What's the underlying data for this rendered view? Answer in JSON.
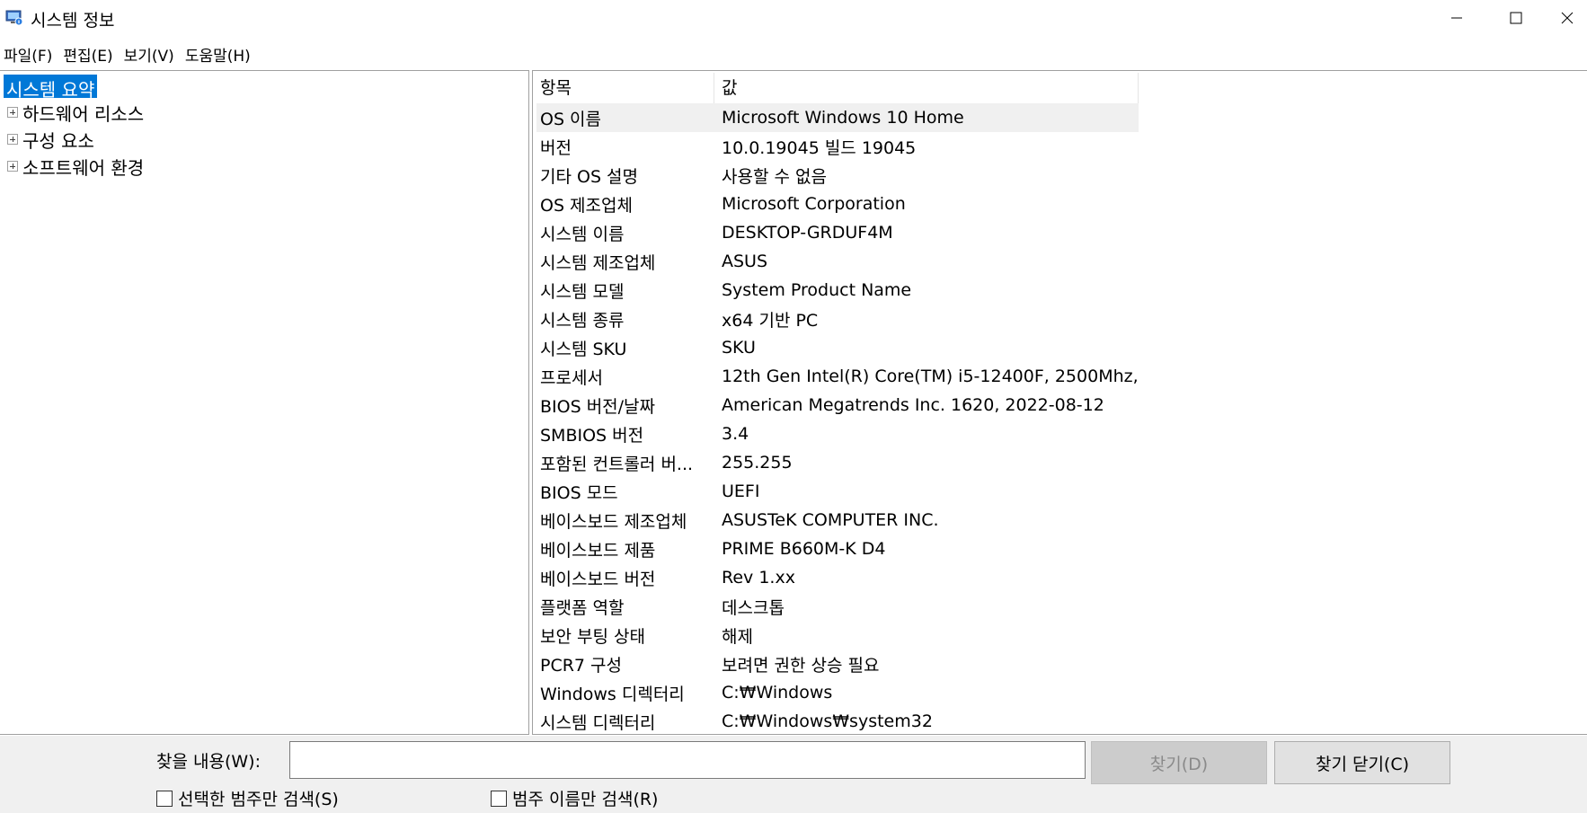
{
  "window": {
    "title": "시스템 정보",
    "icon": "system-info-icon"
  },
  "menu": [
    {
      "label": "파일(F)"
    },
    {
      "label": "편집(E)"
    },
    {
      "label": "보기(V)"
    },
    {
      "label": "도움말(H)"
    }
  ],
  "tree": {
    "root": "시스템 요약",
    "items": [
      {
        "label": "하드웨어 리소스"
      },
      {
        "label": "구성 요소"
      },
      {
        "label": "소프트웨어 환경"
      }
    ]
  },
  "table": {
    "headers": {
      "item": "항목",
      "value": "값"
    },
    "rows": [
      {
        "item": "OS 이름",
        "value": "Microsoft Windows 10 Home"
      },
      {
        "item": "버전",
        "value": "10.0.19045 빌드 19045"
      },
      {
        "item": "기타 OS 설명",
        "value": "사용할 수 없음"
      },
      {
        "item": "OS 제조업체",
        "value": "Microsoft Corporation"
      },
      {
        "item": "시스템 이름",
        "value": "DESKTOP-GRDUF4M"
      },
      {
        "item": "시스템 제조업체",
        "value": "ASUS"
      },
      {
        "item": "시스템 모델",
        "value": "System Product Name"
      },
      {
        "item": "시스템 종류",
        "value": "x64 기반 PC"
      },
      {
        "item": "시스템 SKU",
        "value": "SKU"
      },
      {
        "item": "프로세서",
        "value": "12th Gen Intel(R) Core(TM) i5-12400F, 2500Mhz, ..."
      },
      {
        "item": "BIOS 버전/날짜",
        "value": "American Megatrends Inc. 1620, 2022-08-12"
      },
      {
        "item": "SMBIOS 버전",
        "value": "3.4"
      },
      {
        "item": "포함된 컨트롤러 버...",
        "value": "255.255"
      },
      {
        "item": "BIOS 모드",
        "value": "UEFI"
      },
      {
        "item": "베이스보드 제조업체",
        "value": "ASUSTeK COMPUTER INC."
      },
      {
        "item": "베이스보드 제품",
        "value": "PRIME B660M-K D4"
      },
      {
        "item": "베이스보드 버전",
        "value": "Rev 1.xx"
      },
      {
        "item": "플랫폼 역할",
        "value": "데스크톱"
      },
      {
        "item": "보안 부팅 상태",
        "value": "해제"
      },
      {
        "item": "PCR7 구성",
        "value": "보려면 권한 상승 필요"
      },
      {
        "item": "Windows 디렉터리",
        "value": "C:₩Windows"
      },
      {
        "item": "시스템 디렉터리",
        "value": "C:₩Windows₩system32"
      }
    ]
  },
  "find": {
    "label": "찾을 내용(W):",
    "value": "",
    "find_button": "찾기(D)",
    "close_button": "찾기 닫기(C)",
    "checkbox_selected_category": "선택한 범주만 검색(S)",
    "checkbox_category_names": "범주 이름만 검색(R)"
  },
  "colors": {
    "selection": "#0078d7",
    "row_highlight": "#f0f0f0",
    "bottom_bar": "#f0f0f0"
  }
}
